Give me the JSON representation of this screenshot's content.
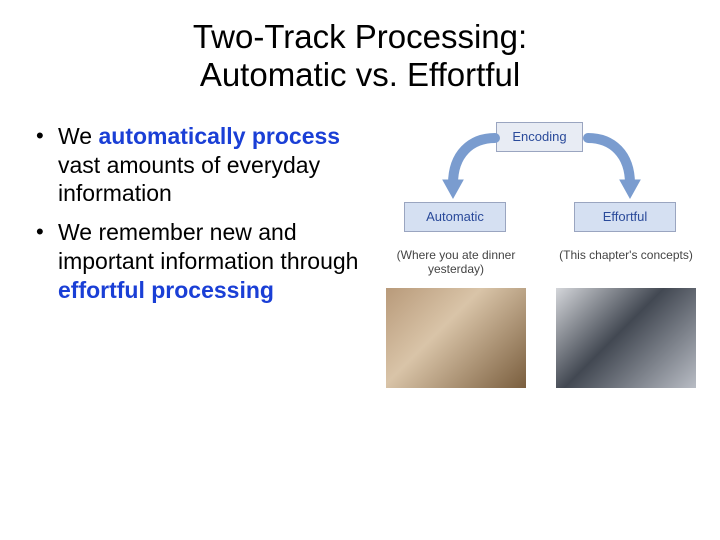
{
  "title_line1": "Two-Track Processing:",
  "title_line2": "Automatic vs. Effortful",
  "bullets": {
    "b1_lead": "We ",
    "b1_bold": "automatically process",
    "b1_rest": " vast amounts of everyday information",
    "b2_lead": "We remember new and important information through ",
    "b2_bold": "effortful processing"
  },
  "diagram": {
    "encoding": "Encoding",
    "automatic": "Automatic",
    "effortful": "Effortful",
    "caption_left": "(Where you ate dinner yesterday)",
    "caption_right": "(This chapter's concepts)"
  }
}
